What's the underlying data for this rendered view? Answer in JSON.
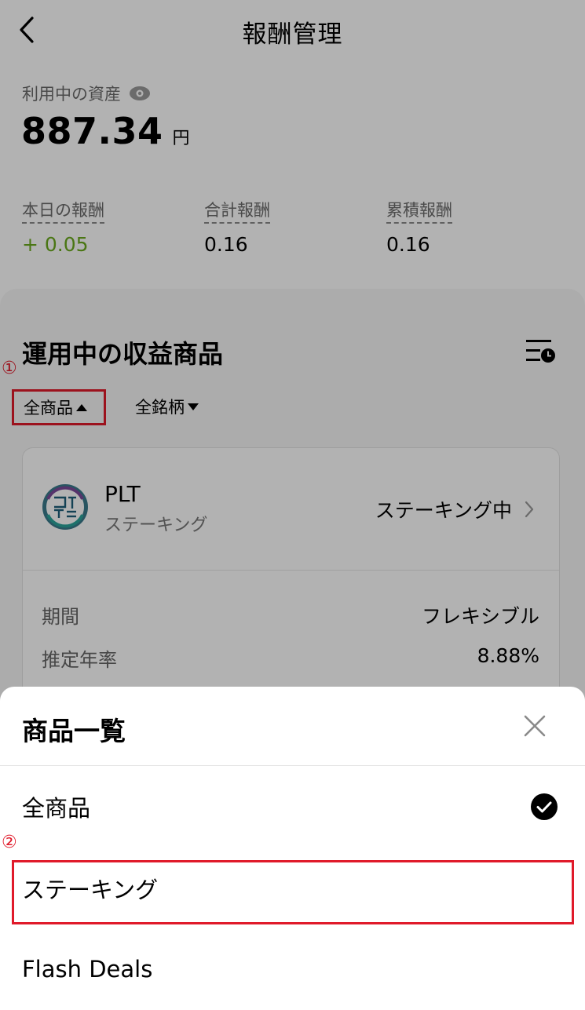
{
  "header": {
    "title": "報酬管理"
  },
  "assets": {
    "label": "利用中の資産",
    "value": "887.34",
    "unit": "円"
  },
  "rewards": [
    {
      "label": "本日の報酬",
      "value": "+ 0.05",
      "positive": true
    },
    {
      "label": "合計報酬",
      "value": "0.16",
      "positive": false
    },
    {
      "label": "累積報酬",
      "value": "0.16",
      "positive": false
    }
  ],
  "section": {
    "title": "運用中の収益商品",
    "filter_product": "全商品",
    "filter_coin": "全銘柄"
  },
  "markers": {
    "one": "①",
    "two": "②"
  },
  "card": {
    "coin": "PLT",
    "type": "ステーキング",
    "status": "ステーキング中",
    "rows": [
      {
        "label": "期間",
        "value": "フレキシブル"
      },
      {
        "label": "推定年率",
        "value": "8.88%"
      }
    ]
  },
  "sheet": {
    "title": "商品一覧",
    "options": [
      "全商品",
      "ステーキング",
      "Flash Deals"
    ],
    "selected_index": 0
  },
  "colors": {
    "positive": "#6aaa1e",
    "highlight": "#e01a2a"
  }
}
